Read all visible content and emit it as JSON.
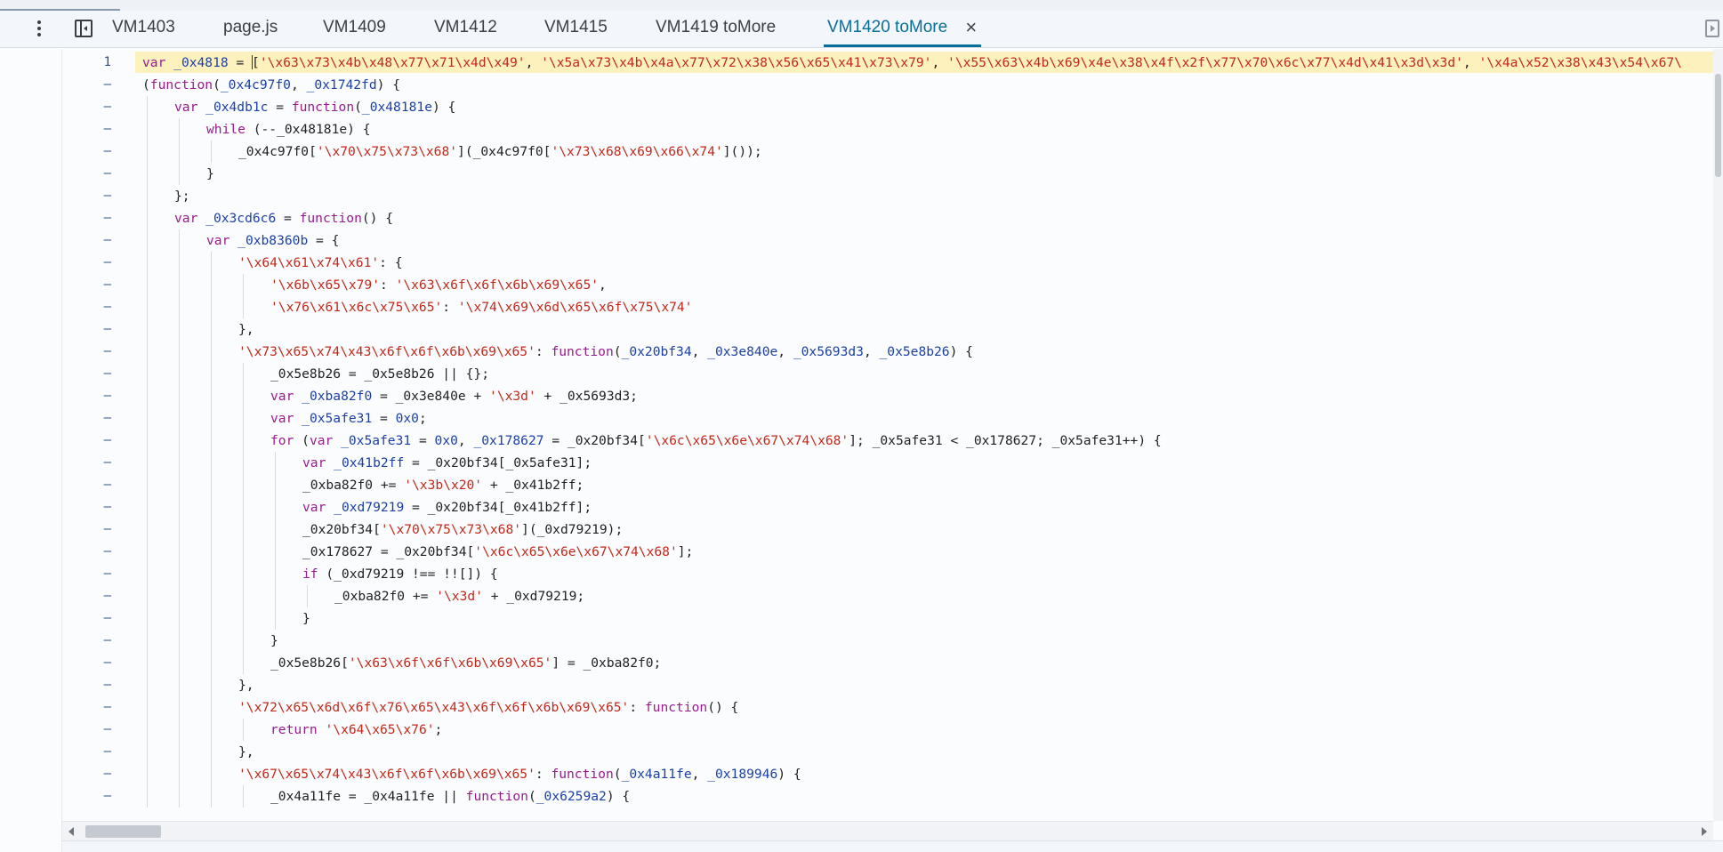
{
  "tabs": [
    {
      "label": "VM1403",
      "active": false
    },
    {
      "label": "page.js",
      "active": false
    },
    {
      "label": "VM1409",
      "active": false
    },
    {
      "label": "VM1412",
      "active": false
    },
    {
      "label": "VM1415",
      "active": false
    },
    {
      "label": "VM1419 toMore",
      "active": false
    },
    {
      "label": "VM1420 toMore",
      "active": true,
      "close": "×"
    }
  ],
  "icons": {
    "menu": "kebab-menu-icon",
    "navigator": "toggle-navigator-icon",
    "debugger": "toggle-debugger-icon",
    "close": "close-icon"
  },
  "colors": {
    "active_tab": "#0b6e99",
    "keyword": "#9a1b8e",
    "string": "#c4281b",
    "variable": "#1c3fa6",
    "highlight_line": "#fdf1be"
  },
  "editor": {
    "lines": [
      {
        "num": "1",
        "depth": 0,
        "hl": true,
        "tokens": [
          {
            "t": "k",
            "x": "var "
          },
          {
            "t": "v",
            "x": "_0x4818"
          },
          {
            "t": "p",
            "x": " = "
          },
          {
            "t": "cursor",
            "x": ""
          },
          {
            "t": "p",
            "x": "["
          },
          {
            "t": "s",
            "x": "'\\x63\\x73\\x4b\\x48\\x77\\x71\\x4d\\x49'"
          },
          {
            "t": "p",
            "x": ", "
          },
          {
            "t": "s",
            "x": "'\\x5a\\x73\\x4b\\x4a\\x77\\x72\\x38\\x56\\x65\\x41\\x73\\x79'"
          },
          {
            "t": "p",
            "x": ", "
          },
          {
            "t": "s",
            "x": "'\\x55\\x63\\x4b\\x69\\x4e\\x38\\x4f\\x2f\\x77\\x70\\x6c\\x77\\x4d\\x41\\x3d\\x3d'"
          },
          {
            "t": "p",
            "x": ", "
          },
          {
            "t": "s",
            "x": "'\\x4a\\x52\\x38\\x43\\x54\\x67\\"
          }
        ]
      },
      {
        "num": "–",
        "depth": 0,
        "tokens": [
          {
            "t": "p",
            "x": "("
          },
          {
            "t": "k",
            "x": "function"
          },
          {
            "t": "p",
            "x": "("
          },
          {
            "t": "v",
            "x": "_0x4c97f0"
          },
          {
            "t": "p",
            "x": ", "
          },
          {
            "t": "v",
            "x": "_0x1742fd"
          },
          {
            "t": "p",
            "x": ") {"
          }
        ]
      },
      {
        "num": "–",
        "depth": 1,
        "tokens": [
          {
            "t": "k",
            "x": "var "
          },
          {
            "t": "v",
            "x": "_0x4db1c"
          },
          {
            "t": "p",
            "x": " = "
          },
          {
            "t": "k",
            "x": "function"
          },
          {
            "t": "p",
            "x": "("
          },
          {
            "t": "v",
            "x": "_0x48181e"
          },
          {
            "t": "p",
            "x": ") {"
          }
        ]
      },
      {
        "num": "–",
        "depth": 2,
        "tokens": [
          {
            "t": "k",
            "x": "while"
          },
          {
            "t": "p",
            "x": " (--_0x48181e) {"
          }
        ]
      },
      {
        "num": "–",
        "depth": 3,
        "tokens": [
          {
            "t": "p",
            "x": "_0x4c97f0["
          },
          {
            "t": "s",
            "x": "'\\x70\\x75\\x73\\x68'"
          },
          {
            "t": "p",
            "x": "](_0x4c97f0["
          },
          {
            "t": "s",
            "x": "'\\x73\\x68\\x69\\x66\\x74'"
          },
          {
            "t": "p",
            "x": "]());"
          }
        ]
      },
      {
        "num": "–",
        "depth": 2,
        "tokens": [
          {
            "t": "p",
            "x": "}"
          }
        ]
      },
      {
        "num": "–",
        "depth": 1,
        "tokens": [
          {
            "t": "p",
            "x": "};"
          }
        ]
      },
      {
        "num": "–",
        "depth": 1,
        "tokens": [
          {
            "t": "k",
            "x": "var "
          },
          {
            "t": "v",
            "x": "_0x3cd6c6"
          },
          {
            "t": "p",
            "x": " = "
          },
          {
            "t": "k",
            "x": "function"
          },
          {
            "t": "p",
            "x": "() {"
          }
        ]
      },
      {
        "num": "–",
        "depth": 2,
        "tokens": [
          {
            "t": "k",
            "x": "var "
          },
          {
            "t": "v",
            "x": "_0xb8360b"
          },
          {
            "t": "p",
            "x": " = {"
          }
        ]
      },
      {
        "num": "–",
        "depth": 3,
        "tokens": [
          {
            "t": "s",
            "x": "'\\x64\\x61\\x74\\x61'"
          },
          {
            "t": "p",
            "x": ": {"
          }
        ]
      },
      {
        "num": "–",
        "depth": 4,
        "tokens": [
          {
            "t": "s",
            "x": "'\\x6b\\x65\\x79'"
          },
          {
            "t": "p",
            "x": ": "
          },
          {
            "t": "s",
            "x": "'\\x63\\x6f\\x6f\\x6b\\x69\\x65'"
          },
          {
            "t": "p",
            "x": ","
          }
        ]
      },
      {
        "num": "–",
        "depth": 4,
        "tokens": [
          {
            "t": "s",
            "x": "'\\x76\\x61\\x6c\\x75\\x65'"
          },
          {
            "t": "p",
            "x": ": "
          },
          {
            "t": "s",
            "x": "'\\x74\\x69\\x6d\\x65\\x6f\\x75\\x74'"
          }
        ]
      },
      {
        "num": "–",
        "depth": 3,
        "tokens": [
          {
            "t": "p",
            "x": "},"
          }
        ]
      },
      {
        "num": "–",
        "depth": 3,
        "tokens": [
          {
            "t": "s",
            "x": "'\\x73\\x65\\x74\\x43\\x6f\\x6f\\x6b\\x69\\x65'"
          },
          {
            "t": "p",
            "x": ": "
          },
          {
            "t": "k",
            "x": "function"
          },
          {
            "t": "p",
            "x": "("
          },
          {
            "t": "v",
            "x": "_0x20bf34"
          },
          {
            "t": "p",
            "x": ", "
          },
          {
            "t": "v",
            "x": "_0x3e840e"
          },
          {
            "t": "p",
            "x": ", "
          },
          {
            "t": "v",
            "x": "_0x5693d3"
          },
          {
            "t": "p",
            "x": ", "
          },
          {
            "t": "v",
            "x": "_0x5e8b26"
          },
          {
            "t": "p",
            "x": ") {"
          }
        ]
      },
      {
        "num": "–",
        "depth": 4,
        "tokens": [
          {
            "t": "p",
            "x": "_0x5e8b26 = _0x5e8b26 || {};"
          }
        ]
      },
      {
        "num": "–",
        "depth": 4,
        "tokens": [
          {
            "t": "k",
            "x": "var "
          },
          {
            "t": "v",
            "x": "_0xba82f0"
          },
          {
            "t": "p",
            "x": " = _0x3e840e + "
          },
          {
            "t": "s",
            "x": "'\\x3d'"
          },
          {
            "t": "p",
            "x": " + _0x5693d3;"
          }
        ]
      },
      {
        "num": "–",
        "depth": 4,
        "tokens": [
          {
            "t": "k",
            "x": "var "
          },
          {
            "t": "v",
            "x": "_0x5afe31"
          },
          {
            "t": "p",
            "x": " = "
          },
          {
            "t": "n",
            "x": "0x0"
          },
          {
            "t": "p",
            "x": ";"
          }
        ]
      },
      {
        "num": "–",
        "depth": 4,
        "tokens": [
          {
            "t": "k",
            "x": "for"
          },
          {
            "t": "p",
            "x": " ("
          },
          {
            "t": "k",
            "x": "var "
          },
          {
            "t": "v",
            "x": "_0x5afe31"
          },
          {
            "t": "p",
            "x": " = "
          },
          {
            "t": "n",
            "x": "0x0"
          },
          {
            "t": "p",
            "x": ", "
          },
          {
            "t": "v",
            "x": "_0x178627"
          },
          {
            "t": "p",
            "x": " = _0x20bf34["
          },
          {
            "t": "s",
            "x": "'\\x6c\\x65\\x6e\\x67\\x74\\x68'"
          },
          {
            "t": "p",
            "x": "]; _0x5afe31 < _0x178627; _0x5afe31++) {"
          }
        ]
      },
      {
        "num": "–",
        "depth": 5,
        "tokens": [
          {
            "t": "k",
            "x": "var "
          },
          {
            "t": "v",
            "x": "_0x41b2ff"
          },
          {
            "t": "p",
            "x": " = _0x20bf34[_0x5afe31];"
          }
        ]
      },
      {
        "num": "–",
        "depth": 5,
        "tokens": [
          {
            "t": "p",
            "x": "_0xba82f0 += "
          },
          {
            "t": "s",
            "x": "'\\x3b\\x20'"
          },
          {
            "t": "p",
            "x": " + _0x41b2ff;"
          }
        ]
      },
      {
        "num": "–",
        "depth": 5,
        "tokens": [
          {
            "t": "k",
            "x": "var "
          },
          {
            "t": "v",
            "x": "_0xd79219"
          },
          {
            "t": "p",
            "x": " = _0x20bf34[_0x41b2ff];"
          }
        ]
      },
      {
        "num": "–",
        "depth": 5,
        "tokens": [
          {
            "t": "p",
            "x": "_0x20bf34["
          },
          {
            "t": "s",
            "x": "'\\x70\\x75\\x73\\x68'"
          },
          {
            "t": "p",
            "x": "](_0xd79219);"
          }
        ]
      },
      {
        "num": "–",
        "depth": 5,
        "tokens": [
          {
            "t": "p",
            "x": "_0x178627 = _0x20bf34["
          },
          {
            "t": "s",
            "x": "'\\x6c\\x65\\x6e\\x67\\x74\\x68'"
          },
          {
            "t": "p",
            "x": "];"
          }
        ]
      },
      {
        "num": "–",
        "depth": 5,
        "tokens": [
          {
            "t": "k",
            "x": "if"
          },
          {
            "t": "p",
            "x": " (_0xd79219 !== !![]) {"
          }
        ]
      },
      {
        "num": "–",
        "depth": 6,
        "tokens": [
          {
            "t": "p",
            "x": "_0xba82f0 += "
          },
          {
            "t": "s",
            "x": "'\\x3d'"
          },
          {
            "t": "p",
            "x": " + _0xd79219;"
          }
        ]
      },
      {
        "num": "–",
        "depth": 5,
        "tokens": [
          {
            "t": "p",
            "x": "}"
          }
        ]
      },
      {
        "num": "–",
        "depth": 4,
        "tokens": [
          {
            "t": "p",
            "x": "}"
          }
        ]
      },
      {
        "num": "–",
        "depth": 4,
        "tokens": [
          {
            "t": "p",
            "x": "_0x5e8b26["
          },
          {
            "t": "s",
            "x": "'\\x63\\x6f\\x6f\\x6b\\x69\\x65'"
          },
          {
            "t": "p",
            "x": "] = _0xba82f0;"
          }
        ]
      },
      {
        "num": "–",
        "depth": 3,
        "tokens": [
          {
            "t": "p",
            "x": "},"
          }
        ]
      },
      {
        "num": "–",
        "depth": 3,
        "tokens": [
          {
            "t": "s",
            "x": "'\\x72\\x65\\x6d\\x6f\\x76\\x65\\x43\\x6f\\x6f\\x6b\\x69\\x65'"
          },
          {
            "t": "p",
            "x": ": "
          },
          {
            "t": "k",
            "x": "function"
          },
          {
            "t": "p",
            "x": "() {"
          }
        ]
      },
      {
        "num": "–",
        "depth": 4,
        "tokens": [
          {
            "t": "k",
            "x": "return "
          },
          {
            "t": "s",
            "x": "'\\x64\\x65\\x76'"
          },
          {
            "t": "p",
            "x": ";"
          }
        ]
      },
      {
        "num": "–",
        "depth": 3,
        "tokens": [
          {
            "t": "p",
            "x": "},"
          }
        ]
      },
      {
        "num": "–",
        "depth": 3,
        "tokens": [
          {
            "t": "s",
            "x": "'\\x67\\x65\\x74\\x43\\x6f\\x6f\\x6b\\x69\\x65'"
          },
          {
            "t": "p",
            "x": ": "
          },
          {
            "t": "k",
            "x": "function"
          },
          {
            "t": "p",
            "x": "("
          },
          {
            "t": "v",
            "x": "_0x4a11fe"
          },
          {
            "t": "p",
            "x": ", "
          },
          {
            "t": "v",
            "x": "_0x189946"
          },
          {
            "t": "p",
            "x": ") {"
          }
        ]
      },
      {
        "num": "–",
        "depth": 4,
        "tokens": [
          {
            "t": "p",
            "x": "_0x4a11fe = _0x4a11fe || "
          },
          {
            "t": "k",
            "x": "function"
          },
          {
            "t": "p",
            "x": "("
          },
          {
            "t": "v",
            "x": "_0x6259a2"
          },
          {
            "t": "p",
            "x": ") {"
          }
        ]
      }
    ]
  }
}
